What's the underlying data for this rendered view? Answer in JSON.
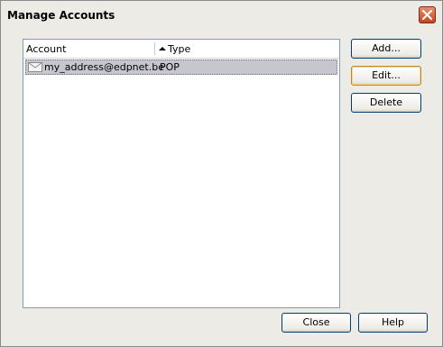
{
  "window": {
    "title": "Manage Accounts"
  },
  "list": {
    "columns": [
      {
        "label": "Account"
      },
      {
        "label": "Type",
        "sorted": "ascending"
      }
    ],
    "rows": [
      {
        "account": "my_address@edpnet.be",
        "type": "POP",
        "icon": "envelope-icon",
        "selected": true
      }
    ]
  },
  "buttons": {
    "add": "Add...",
    "edit": "Edit...",
    "delete": "Delete",
    "close": "Close",
    "help": "Help"
  },
  "colors": {
    "window_bg": "#ecebe6",
    "selection": "#c6c6ce",
    "close_button": "#c8431f",
    "focus_border": "#b9892b"
  }
}
